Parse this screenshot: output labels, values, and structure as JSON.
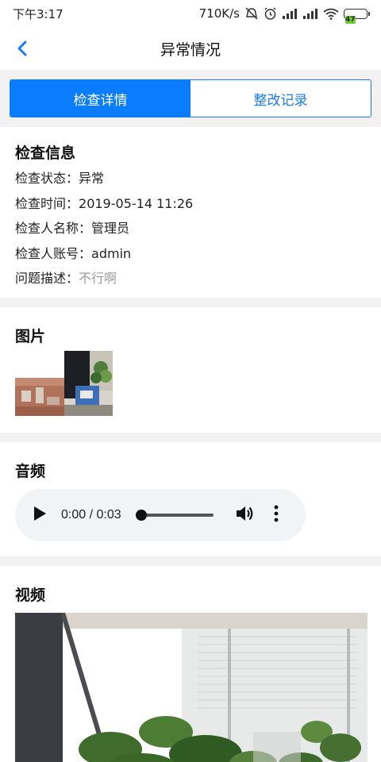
{
  "status_bar": {
    "time": "下午3:17",
    "network_speed": "710K/s",
    "battery_level": "47"
  },
  "nav": {
    "title": "异常情况",
    "back_icon": "chevron-left-icon"
  },
  "tabs": [
    {
      "label": "检查详情",
      "active": true
    },
    {
      "label": "整改记录",
      "active": false
    }
  ],
  "inspection_info": {
    "section_title": "检查信息",
    "rows": [
      {
        "label": "检查状态：",
        "value": "异常"
      },
      {
        "label": "检查时间：",
        "value": "2019-05-14 11:26"
      },
      {
        "label": "检查人名称：",
        "value": "管理员"
      },
      {
        "label": "检查人账号：",
        "value": "admin"
      },
      {
        "label": "问题描述：",
        "value": "不行啊"
      }
    ]
  },
  "images": {
    "section_title": "图片"
  },
  "audio": {
    "section_title": "音频",
    "time_display": "0:00 / 0:03",
    "progress": 0,
    "play_icon": "play-icon",
    "volume_icon": "volume-icon",
    "more_icon": "more-vertical-icon"
  },
  "video": {
    "section_title": "视频"
  },
  "colors": {
    "accent": "#0a7dff",
    "muted_text": "#999999",
    "battery_fill": "#6fce33"
  }
}
